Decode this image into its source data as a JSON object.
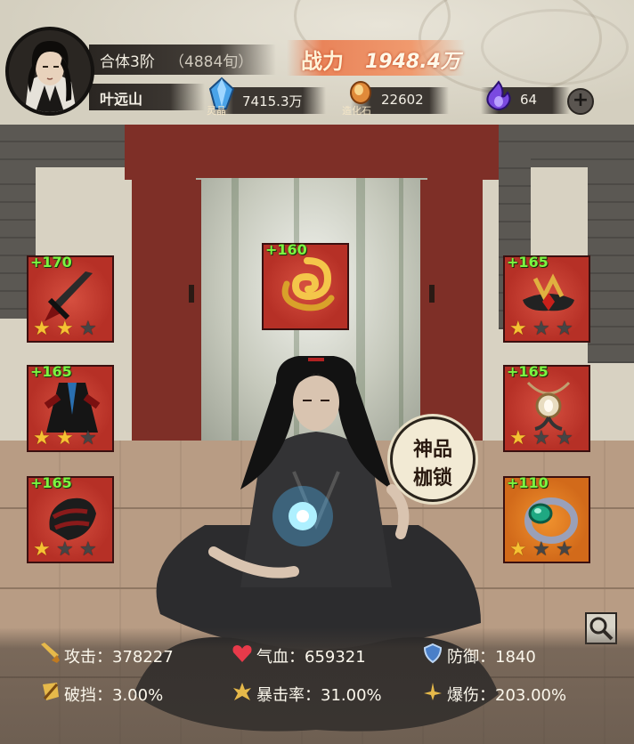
{
  "header": {
    "rank": "合体3阶",
    "rank_age": "（4884旬）",
    "player_name": "叶远山",
    "power_label": "战力",
    "power_value": "1948.4万",
    "currencies": [
      {
        "icon": "spirit-crystal-icon",
        "label": "灵晶",
        "value": "7415.3万"
      },
      {
        "icon": "fortune-stone-icon",
        "label": "造化石",
        "value": "22602"
      },
      {
        "icon": "purple-flame-icon",
        "label": "",
        "value": "64"
      }
    ],
    "add_button": "+"
  },
  "equipment": {
    "left": [
      {
        "level": "+170",
        "item": "dagger-icon",
        "stars": 2
      },
      {
        "level": "+165",
        "item": "robe-icon",
        "stars": 2
      },
      {
        "level": "+165",
        "item": "gauntlet-icon",
        "stars": 1
      }
    ],
    "center": {
      "level": "+160",
      "item": "golden-dragon-icon"
    },
    "right": [
      {
        "level": "+165",
        "item": "crown-headband-icon",
        "stars": 1
      },
      {
        "level": "+165",
        "item": "amulet-icon",
        "stars": 1
      },
      {
        "level": "+110",
        "item": "jade-ring-icon",
        "stars": 1
      }
    ]
  },
  "badge": {
    "line1": "神品",
    "line2": "枷锁"
  },
  "stats": {
    "attack": "攻击：378227",
    "hp": "气血：659321",
    "defense": "防御：1840",
    "block_break": "破挡：3.00%",
    "crit_rate": "暴击率：31.00%",
    "crit_damage": "爆伤：203.00%"
  },
  "colors": {
    "slot_red": "#c23c30",
    "slot_orange": "#e07a24",
    "level_green": "#7cf541",
    "star_gold": "#f5c233",
    "power_orange": "#e9845a"
  }
}
